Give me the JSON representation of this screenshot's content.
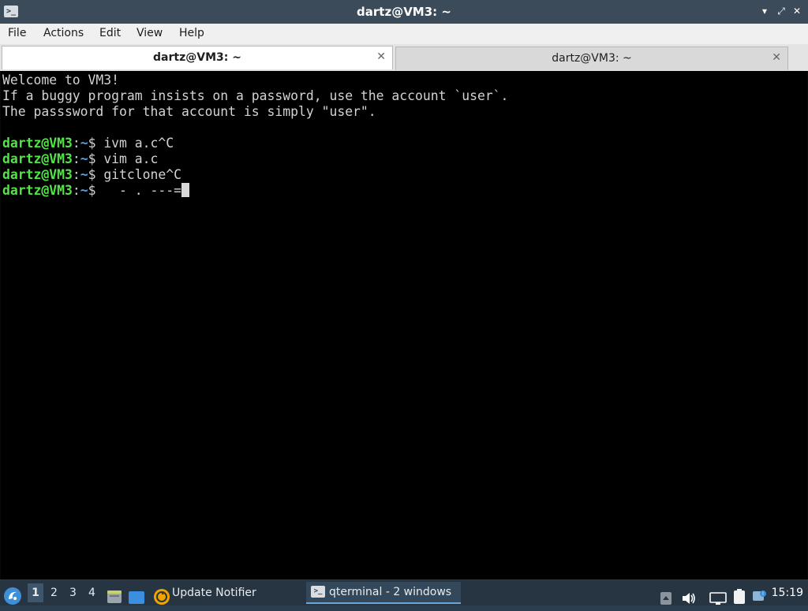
{
  "window": {
    "title": "dartz@VM3: ~",
    "controls": {
      "minimize": "▾",
      "maximize": "⤢",
      "close": "✕"
    }
  },
  "menu": [
    "File",
    "Actions",
    "Edit",
    "View",
    "Help"
  ],
  "tabs": [
    {
      "label": "dartz@VM3: ~",
      "active": true
    },
    {
      "label": "dartz@VM3: ~",
      "active": false
    }
  ],
  "terminal": {
    "motd": [
      "Welcome to VM3!",
      "If a buggy program insists on a password, use the account `user`.",
      "The passsword for that account is simply \"user\"."
    ],
    "prompt_user": "dartz@VM3",
    "prompt_sep": ":",
    "prompt_path": "~",
    "prompt_dollar": "$ ",
    "commands": [
      "ivm a.c^C",
      "vim a.c",
      "gitclone^C",
      "  - . ---="
    ]
  },
  "taskbar": {
    "desktops": [
      "1",
      "2",
      "3",
      "4"
    ],
    "active_desktop": "1",
    "notifier_label": "Update Notifier",
    "task_label": "qterminal - 2 windows",
    "clock": "15:19"
  },
  "colors": {
    "prompt_user": "#55e34a",
    "prompt_path": "#4fa3e8",
    "terminal_bg": "#000000",
    "taskbar_bg": "#273442"
  }
}
